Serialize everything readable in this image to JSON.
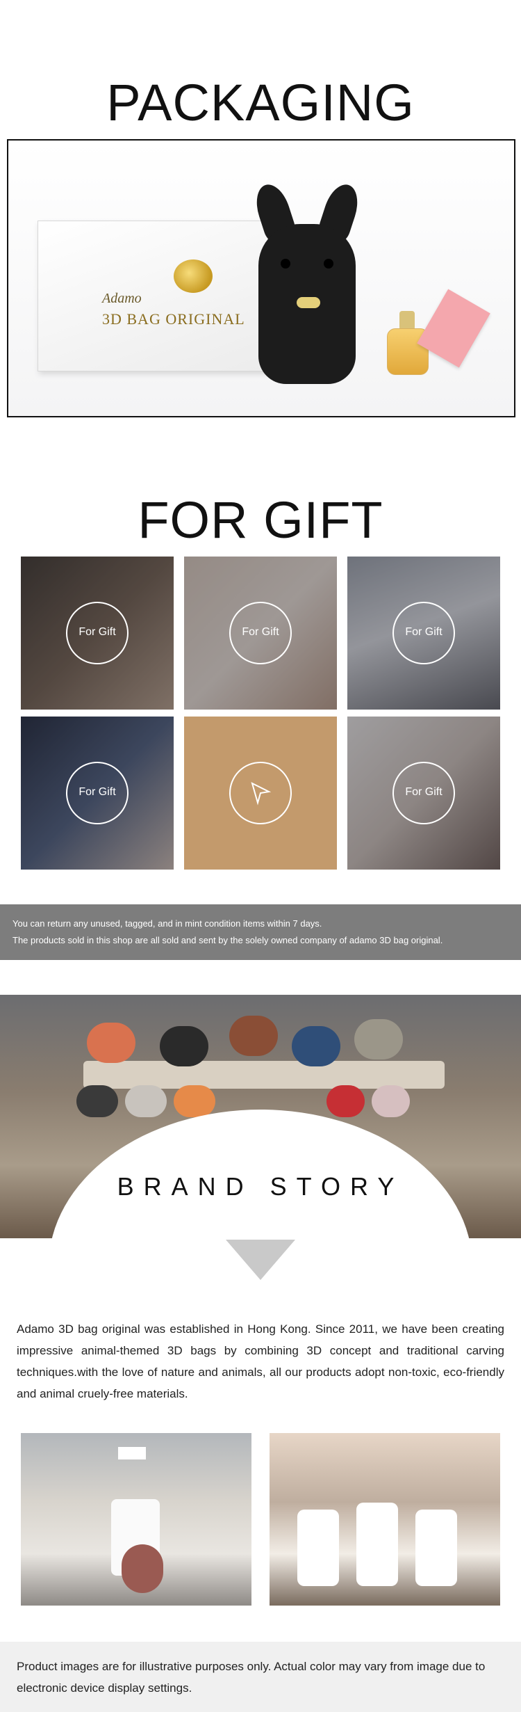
{
  "packaging": {
    "title": "PACKAGING",
    "box_script": "Adamo",
    "box_brand": "3D BAG ORIGINAL"
  },
  "gift": {
    "title": "FOR GIFT",
    "tiles": [
      {
        "label": "For Gift",
        "photo_desc": "family"
      },
      {
        "label": "For Gift",
        "photo_desc": "couple"
      },
      {
        "label": "For Gift",
        "photo_desc": "meeting"
      },
      {
        "label": "For Gift",
        "photo_desc": "friends-train"
      },
      {
        "label": "",
        "photo_desc": "arrow",
        "icon": "cursor-arrow-icon"
      },
      {
        "label": "For Gift",
        "photo_desc": "parent-child"
      }
    ]
  },
  "notice": {
    "line1": "You can return any unused, tagged, and in mint condition items within 7 days.",
    "line2": "The products sold in this shop are all sold and sent by the solely owned company of adamo 3D bag original."
  },
  "brand_story": {
    "title": "BRAND STORY",
    "text": "Adamo 3D bag original was established in Hong Kong. Since 2011, we have been creating impressive animal-themed 3D bags by combining 3D concept and traditional carving techniques.with the love of nature and animals, all our products adopt non-toxic, eco-friendly and animal cruely-free materials."
  },
  "footer": {
    "note": "Product images are for illustrative purposes only. Actual color may vary from image due to electronic device display settings."
  },
  "colors": {
    "notice_bg": "#7d7d7d",
    "gift_accent": "#c39a6c",
    "footer_bg": "#f0f0f0"
  }
}
